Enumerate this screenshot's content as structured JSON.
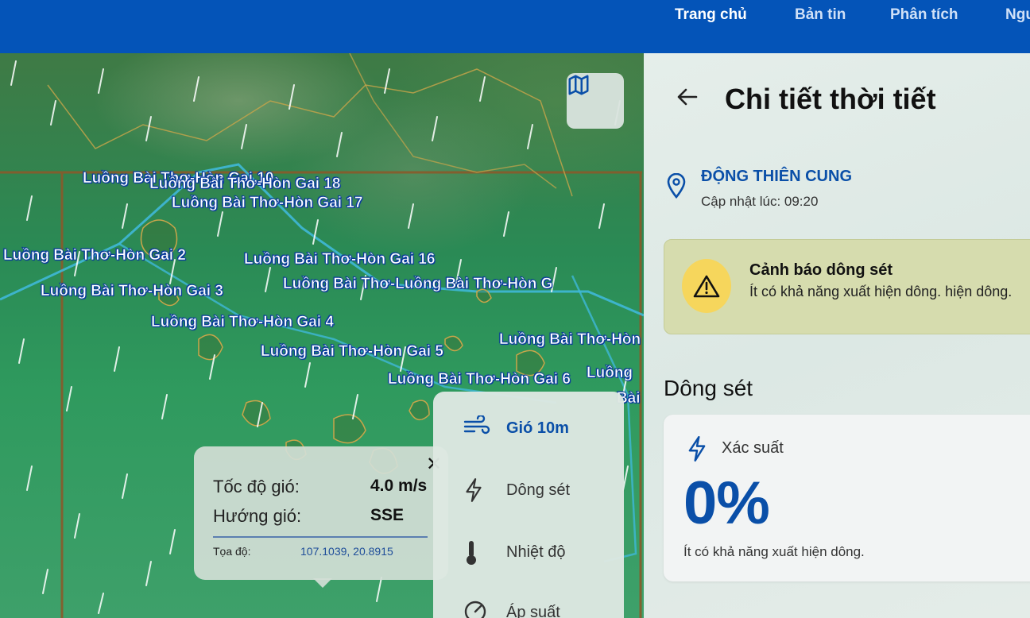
{
  "nav": {
    "items": [
      "Trang chủ",
      "Bản tin",
      "Phân tích",
      "Ngư"
    ]
  },
  "map": {
    "route_labels": [
      "Luồng Bài Thơ-Hòn Gai 18",
      "Luồng Bài Thơ-Hòn Gai 10",
      "Luồng Bài Thơ-Hòn Gai 17",
      "Luồng Bài Thơ-Hòn Gai 2",
      "Luồng Bài Thơ-Hòn Gai 16",
      "Luồng Bài Thơ-Hòn Gai 3",
      "Luồng Bài Thơ-Luồng Bài Thơ-Hòn G",
      "Luồng Bài Thơ-Hòn Gai 4",
      "Luồng Bài Thơ-Hòn",
      "Luồng Bài Thơ-Hòn Gai 5",
      "Luồng Bài Thơ-Hòn Gai 6",
      "Luồng",
      "Bài"
    ],
    "map_button_icon": "map-icon"
  },
  "popup": {
    "speed_label": "Tốc độ gió:",
    "speed_value": "4.0 m/s",
    "direction_label": "Hướng gió:",
    "direction_value": "SSE",
    "coord_label": "Tọa độ:",
    "coord_value": "107.1039, 20.8915",
    "close_icon": "close-icon"
  },
  "layers": {
    "items": [
      {
        "label": "Gió 10m",
        "icon": "wind-icon",
        "active": true
      },
      {
        "label": "Dông sét",
        "icon": "lightning-icon",
        "active": false
      },
      {
        "label": "Nhiệt độ",
        "icon": "thermometer-icon",
        "active": false
      },
      {
        "label": "Áp suất",
        "icon": "gauge-icon",
        "active": false
      }
    ]
  },
  "panel": {
    "title": "Chi tiết thời tiết",
    "location_name": "ĐỘNG THIÊN CUNG",
    "updated": "Cập nhật lúc: 09:20",
    "alert": {
      "title": "Cảnh báo dông sét",
      "text": "Ít có khả năng xuất hiện dông. hiện dông."
    },
    "section_title": "Dông sét",
    "card": {
      "label": "Xác suất",
      "value": "0%",
      "description": "Ít có khả năng xuất hiện dông."
    }
  },
  "colors": {
    "topbar": "#0454b8",
    "accent": "#0a4fa8",
    "alert_bg": "#d6dcae",
    "alert_badge": "#f6d65c"
  }
}
